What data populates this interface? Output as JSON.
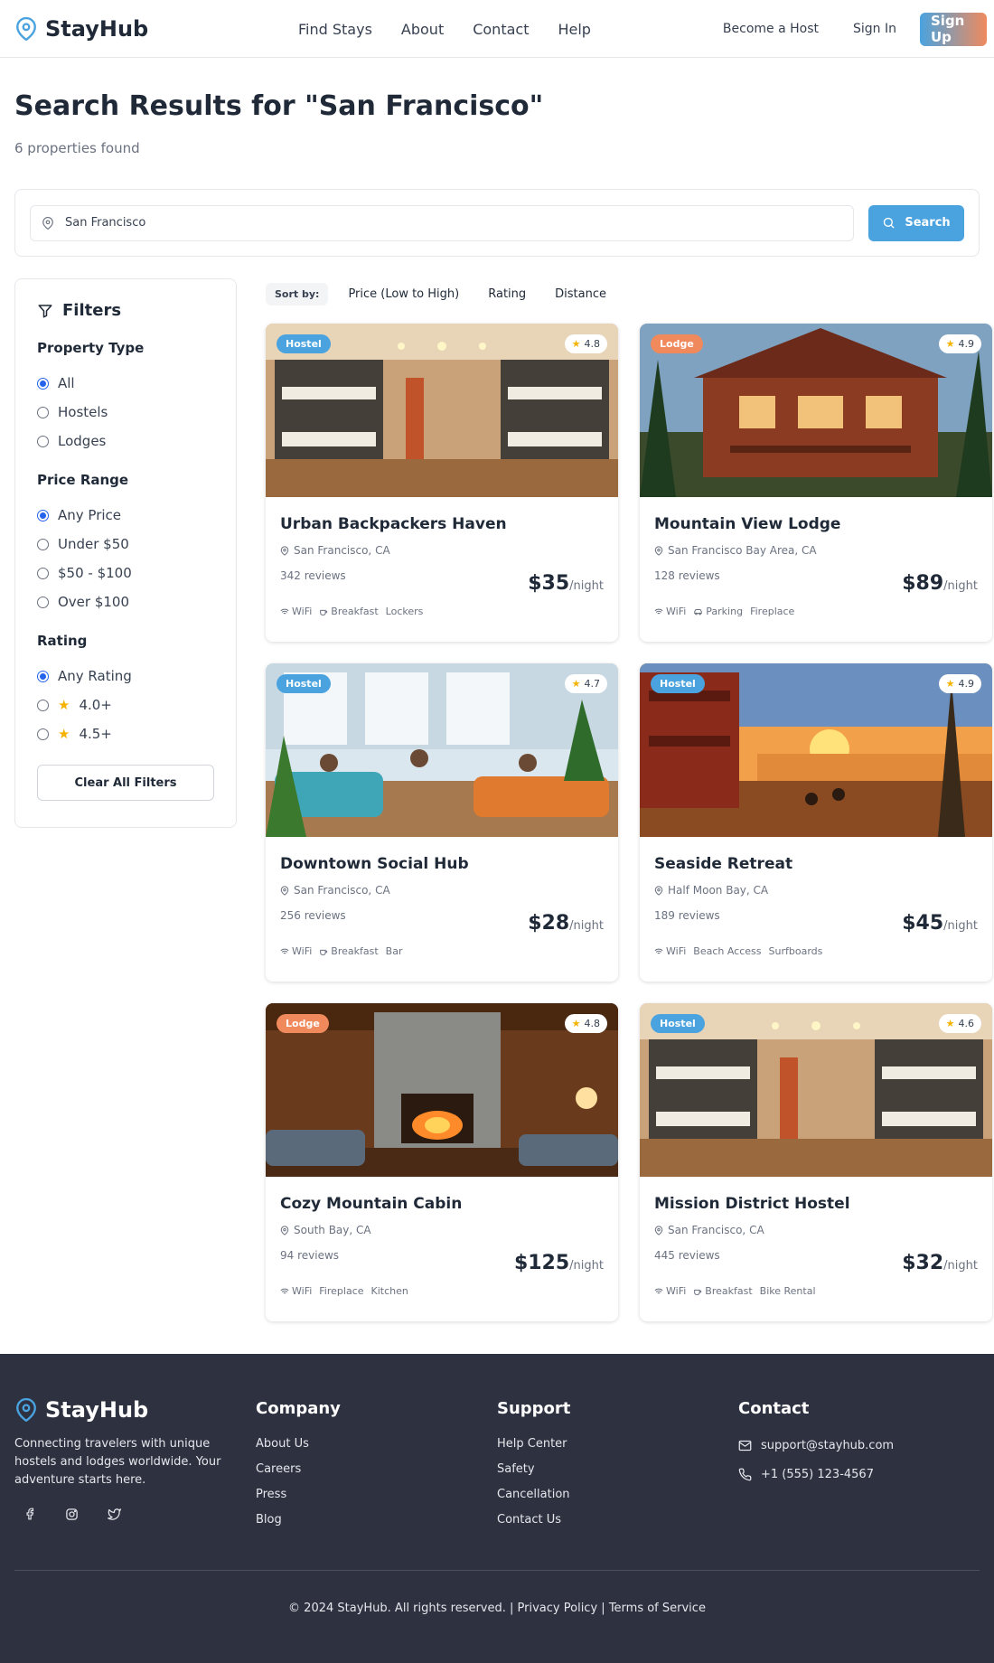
{
  "brand": {
    "name": "StayHub",
    "accent": "#4aa3df",
    "secondary": "#f08a5d"
  },
  "nav": {
    "links": [
      "Find Stays",
      "About",
      "Contact",
      "Help"
    ],
    "become_host": "Become a Host",
    "sign_in": "Sign In",
    "sign_up": "Sign Up"
  },
  "header": {
    "title": "Search Results for \"San Francisco\"",
    "count": "6 properties found"
  },
  "search": {
    "value": "San Francisco",
    "button": "Search"
  },
  "filters": {
    "title": "Filters",
    "property_type": {
      "title": "Property Type",
      "options": [
        "All",
        "Hostels",
        "Lodges"
      ],
      "selected": "All"
    },
    "price_range": {
      "title": "Price Range",
      "options": [
        "Any Price",
        "Under $50",
        "$50 - $100",
        "Over $100"
      ],
      "selected": "Any Price"
    },
    "rating": {
      "title": "Rating",
      "options": [
        "Any Rating",
        "4.0+",
        "4.5+"
      ],
      "selected": "Any Rating"
    },
    "clear": "Clear All Filters"
  },
  "sort": {
    "label": "Sort by:",
    "options": [
      "Price (Low to High)",
      "Rating",
      "Distance"
    ]
  },
  "listings": [
    {
      "type": "Hostel",
      "rating": "4.8",
      "name": "Urban Backpackers Haven",
      "location": "San Francisco, CA",
      "reviews": "342 reviews",
      "price": "$35",
      "per": "/night",
      "amenities": [
        "WiFi",
        "Breakfast",
        "Lockers"
      ],
      "image": "dorm-bunk-beds"
    },
    {
      "type": "Lodge",
      "rating": "4.9",
      "name": "Mountain View Lodge",
      "location": "San Francisco Bay Area, CA",
      "reviews": "128 reviews",
      "price": "$89",
      "per": "/night",
      "amenities": [
        "WiFi",
        "Parking",
        "Fireplace"
      ],
      "image": "wooden-lodge-exterior"
    },
    {
      "type": "Hostel",
      "rating": "4.7",
      "name": "Downtown Social Hub",
      "location": "San Francisco, CA",
      "reviews": "256 reviews",
      "price": "$28",
      "per": "/night",
      "amenities": [
        "WiFi",
        "Breakfast",
        "Bar"
      ],
      "image": "lounge-with-people"
    },
    {
      "type": "Hostel",
      "rating": "4.9",
      "name": "Seaside Retreat",
      "location": "Half Moon Bay, CA",
      "reviews": "189 reviews",
      "price": "$45",
      "per": "/night",
      "amenities": [
        "WiFi",
        "Beach Access",
        "Surfboards"
      ],
      "image": "beach-sunset"
    },
    {
      "type": "Lodge",
      "rating": "4.8",
      "name": "Cozy Mountain Cabin",
      "location": "South Bay, CA",
      "reviews": "94 reviews",
      "price": "$125",
      "per": "/night",
      "amenities": [
        "WiFi",
        "Fireplace",
        "Kitchen"
      ],
      "image": "cabin-fireplace"
    },
    {
      "type": "Hostel",
      "rating": "4.6",
      "name": "Mission District Hostel",
      "location": "San Francisco, CA",
      "reviews": "445 reviews",
      "price": "$32",
      "per": "/night",
      "amenities": [
        "WiFi",
        "Breakfast",
        "Bike Rental"
      ],
      "image": "dorm-bunk-beds"
    }
  ],
  "footer": {
    "brand": "StayHub",
    "description": "Connecting travelers with unique hostels and lodges worldwide. Your adventure starts here.",
    "socials": [
      "facebook-icon",
      "instagram-icon",
      "twitter-icon"
    ],
    "company": {
      "title": "Company",
      "links": [
        "About Us",
        "Careers",
        "Press",
        "Blog"
      ]
    },
    "support": {
      "title": "Support",
      "links": [
        "Help Center",
        "Safety",
        "Cancellation",
        "Contact Us"
      ]
    },
    "contact": {
      "title": "Contact",
      "email": "support@stayhub.com",
      "phone": "+1 (555) 123-4567"
    },
    "copyright": "© 2024 StayHub. All rights reserved.",
    "privacy": "Privacy Policy",
    "terms": "Terms of Service"
  }
}
